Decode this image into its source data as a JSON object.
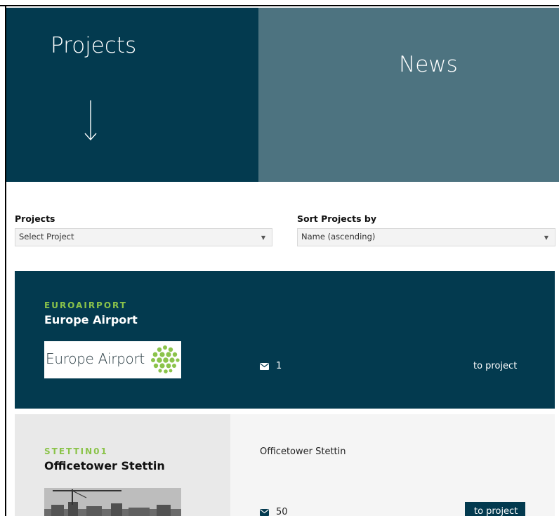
{
  "tabs": {
    "projects_label": "Projects",
    "news_label": "News"
  },
  "filters": {
    "project_label": "Projects",
    "project_placeholder": "Select Project",
    "sort_label": "Sort Projects by",
    "sort_value": "Name (ascending)"
  },
  "projects": [
    {
      "code": "EUROAIRPORT",
      "name": "Europe Airport",
      "logo_text": "Europe Airport",
      "description": "",
      "message_count": "1",
      "link_label": "to project"
    },
    {
      "code": "STETTIN01",
      "name": "Officetower Stettin",
      "description": "Officetower Stettin",
      "message_count": "50",
      "link_label": "to project"
    }
  ],
  "colors": {
    "primary": "#033a4f",
    "secondary": "#4d7380",
    "accent": "#8bc34a"
  }
}
